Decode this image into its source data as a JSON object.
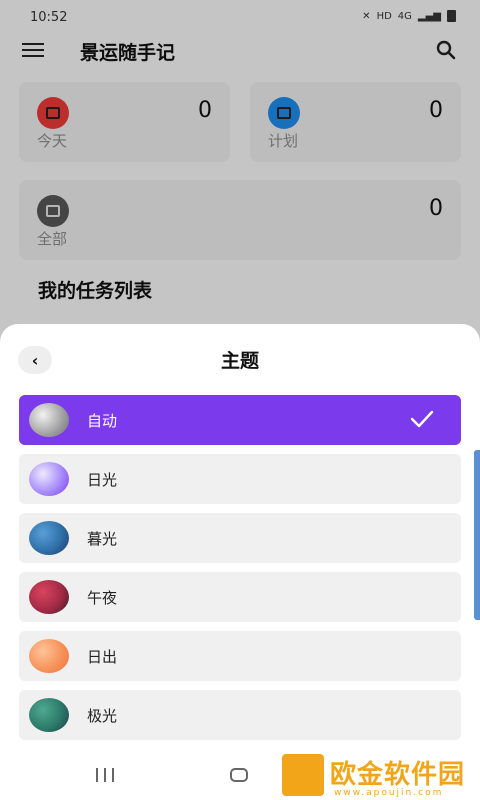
{
  "status": {
    "time": "10:52",
    "network": "HD",
    "signal": "4G"
  },
  "header": {
    "title": "景运随手记"
  },
  "cards": [
    {
      "label": "今天",
      "count": "0",
      "icon": "calendar-today-icon",
      "color": "#e53935"
    },
    {
      "label": "计划",
      "count": "0",
      "icon": "calendar-plan-icon",
      "color": "#1e88e5"
    },
    {
      "label": "全部",
      "count": "0",
      "icon": "inbox-icon",
      "color": "#555555"
    }
  ],
  "section": {
    "title": "我的任务列表"
  },
  "sheet": {
    "title": "主题",
    "themes": [
      {
        "name": "自动",
        "selected": true,
        "color": "#a8a8a8"
      },
      {
        "name": "日光",
        "selected": false,
        "color": "#a78bfa"
      },
      {
        "name": "暮光",
        "selected": false,
        "color": "#2f6fa8"
      },
      {
        "name": "午夜",
        "selected": false,
        "color": "#a32a44"
      },
      {
        "name": "日出",
        "selected": false,
        "color": "#f7935a"
      },
      {
        "name": "极光",
        "selected": false,
        "color": "#2c7a68"
      }
    ]
  },
  "accent_color": "#7c3aed",
  "watermark": {
    "text": "欧金软件园",
    "url": "www.apoujin.com"
  }
}
